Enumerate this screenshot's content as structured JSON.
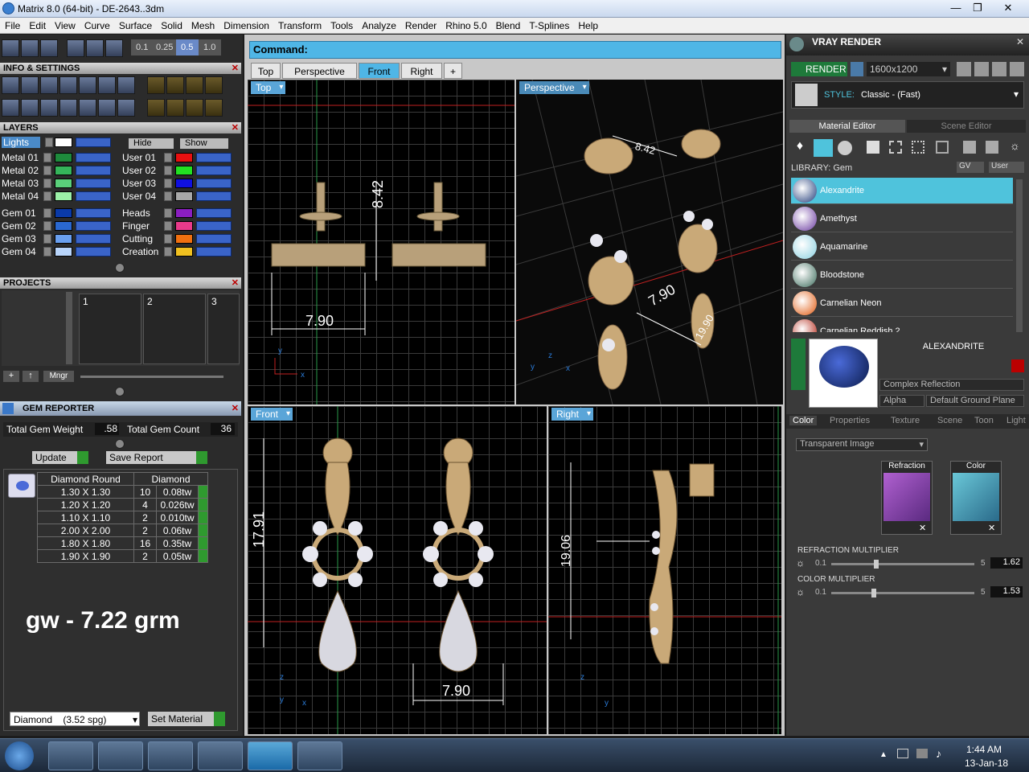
{
  "window": {
    "title": "Matrix 8.0 (64-bit) - DE-2643..3dm",
    "minimize": "—",
    "maximize": "❐",
    "close": "✕"
  },
  "menu": [
    "File",
    "Edit",
    "View",
    "Curve",
    "Surface",
    "Solid",
    "Mesh",
    "Dimension",
    "Transform",
    "Tools",
    "Analyze",
    "Render",
    "Rhino 5.0",
    "Blend",
    "T-Splines",
    "Help"
  ],
  "toolbar": {
    "steps": [
      "0.1",
      "0.25",
      "0.5",
      "1.0"
    ]
  },
  "info_settings": {
    "title": "INFO & SETTINGS"
  },
  "layers": {
    "title": "LAYERS",
    "lights": "Lights",
    "hide": "Hide",
    "show": "Show",
    "left": [
      {
        "name": "Metal 01",
        "color": "#1e8a3c"
      },
      {
        "name": "Metal 02",
        "color": "#35b45a"
      },
      {
        "name": "Metal 03",
        "color": "#5ad07a"
      },
      {
        "name": "Metal 04",
        "color": "#9cf0a8"
      },
      {
        "name": "Gem 01",
        "color": "#0a3aa8"
      },
      {
        "name": "Gem 02",
        "color": "#2a68d0"
      },
      {
        "name": "Gem 03",
        "color": "#6aa0f0"
      },
      {
        "name": "Gem 04",
        "color": "#b8d4fa"
      }
    ],
    "right": [
      {
        "name": "User 01",
        "color": "#e81010"
      },
      {
        "name": "User 02",
        "color": "#22e022"
      },
      {
        "name": "User 03",
        "color": "#1010e0"
      },
      {
        "name": "User 04",
        "color": "#a8a8a8"
      },
      {
        "name": "Heads",
        "color": "#8a1ec0"
      },
      {
        "name": "Finger",
        "color": "#e83a8a"
      },
      {
        "name": "Cutting",
        "color": "#f07010"
      },
      {
        "name": "Creation",
        "color": "#f0c020"
      }
    ]
  },
  "projects": {
    "title": "PROJECTS",
    "slots": [
      "1",
      "2",
      "3"
    ],
    "mngr": "Mngr"
  },
  "gem_reporter": {
    "title": "GEM REPORTER",
    "weight_label": "Total Gem Weight",
    "weight_value": ".58",
    "count_label": "Total Gem Count",
    "count_value": "36",
    "update": "Update",
    "save_report": "Save Report",
    "col1": "Diamond Round",
    "col2": "Diamond",
    "rows": [
      {
        "size": "1.30 X 1.30",
        "count": "10",
        "wt": "0.08tw"
      },
      {
        "size": "1.20 X 1.20",
        "count": "4",
        "wt": "0.026tw"
      },
      {
        "size": "1.10 X 1.10",
        "count": "2",
        "wt": "0.010tw"
      },
      {
        "size": "2.00 X 2.00",
        "count": "2",
        "wt": "0.06tw"
      },
      {
        "size": "1.80 X 1.80",
        "count": "16",
        "wt": "0.35tw"
      },
      {
        "size": "1.90 X 1.90",
        "count": "2",
        "wt": "0.05tw"
      }
    ],
    "note": "gw - 7.22 grm",
    "material_select": "Diamond    (3.52 spg)",
    "set_material": "Set Material"
  },
  "command": {
    "label": "Command:",
    "value": ""
  },
  "view_tabs": [
    "Top",
    "Perspective",
    "Front",
    "Right",
    "+"
  ],
  "active_view_tab": "Front",
  "viewports": {
    "top": {
      "label": "Top",
      "dim_h": "8.42",
      "dim_w": "7.90",
      "axis_y": "y",
      "axis_x": "x"
    },
    "perspective": {
      "label": "Perspective",
      "dim_a": "8.42",
      "dim_b": "7.90",
      "dim_c": "19.90",
      "axis_z": "z",
      "axis_y": "y",
      "axis_x": "x"
    },
    "front": {
      "label": "Front",
      "dim_h": "17.91",
      "dim_w": "7.90",
      "axis_z": "z",
      "axis_y": "y",
      "axis_x": "x"
    },
    "right": {
      "label": "Right",
      "dim_h": "19.06",
      "axis_z": "z",
      "axis_y": "y"
    }
  },
  "vray": {
    "title": "VRAY RENDER",
    "render": "RENDER",
    "resolution": "1600x1200",
    "style_label": "STYLE:",
    "style_value": "Classic - (Fast)",
    "tab_material": "Material Editor",
    "tab_scene": "Scene Editor",
    "library_label": "LIBRARY: Gem",
    "gv": "GV",
    "user": "User",
    "library": [
      {
        "name": "Alexandrite",
        "color": "#1f3a78"
      },
      {
        "name": "Amethyst",
        "color": "#6a3aa0"
      },
      {
        "name": "Aquamarine",
        "color": "#8ad0e0"
      },
      {
        "name": "Bloodstone",
        "color": "#3a6a5a"
      },
      {
        "name": "Carnelian Neon",
        "color": "#e05a10"
      },
      {
        "name": "Carnelian Reddish 2",
        "color": "#b02010"
      }
    ],
    "selected_name": "ALEXANDRITE",
    "reflection": "Complex Reflection",
    "alpha": "Alpha",
    "ground": "Default Ground Plane",
    "subtabs": [
      "Color",
      "Properties",
      "Texture",
      "Scene",
      "Toon",
      "Light"
    ],
    "transparency": "Transparent Image",
    "refraction_label": "Refraction",
    "color_label": "Color",
    "refraction_multiplier": {
      "label": "REFRACTION MULTIPLIER",
      "min": "0.1",
      "max": "5",
      "value": "1.62",
      "level": 0.31
    },
    "color_multiplier": {
      "label": "COLOR MULTIPLIER",
      "min": "0.1",
      "max": "5",
      "value": "1.53",
      "level": 0.29
    }
  },
  "taskbar": {
    "time": "1:44 AM",
    "date": "13-Jan-18"
  }
}
